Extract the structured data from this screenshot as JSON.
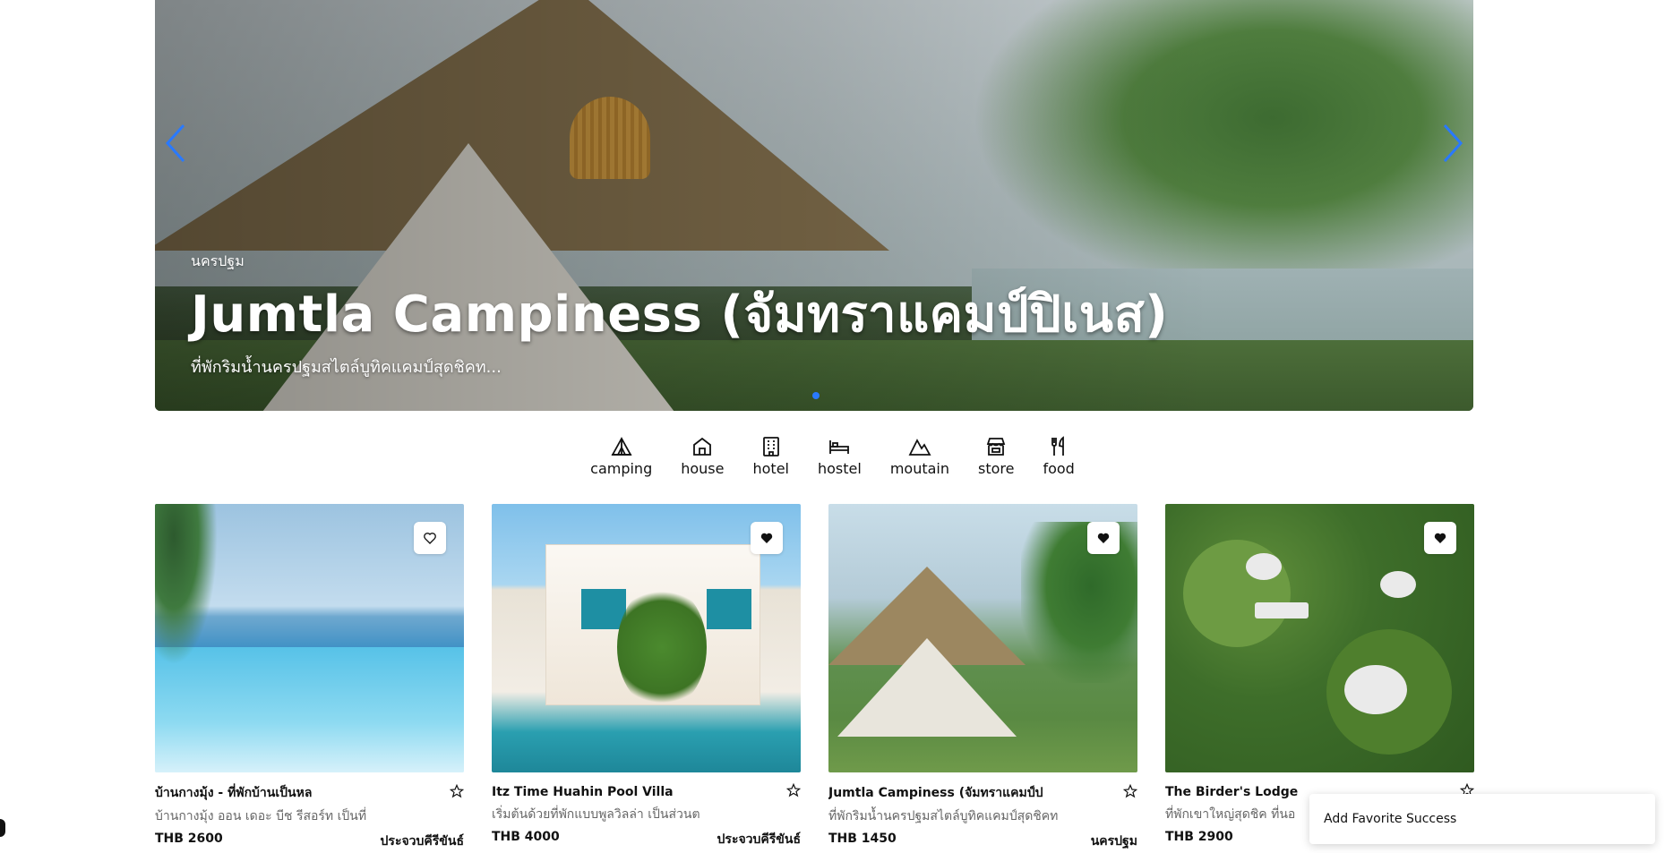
{
  "hero": {
    "province": "นครปฐม",
    "title": "Jumtla Campiness (จัมทราแคมป์ปิเนส)",
    "description": "ที่พักริมน้ำนครปฐมสไตล์บูทิคแคมป์สุดชิคท...",
    "prev_icon": "chevron-left-icon",
    "next_icon": "chevron-right-icon",
    "dot_color": "#2979ff"
  },
  "categories": [
    {
      "label": "camping",
      "icon": "tent-icon"
    },
    {
      "label": "house",
      "icon": "house-icon"
    },
    {
      "label": "hotel",
      "icon": "building-icon"
    },
    {
      "label": "hostel",
      "icon": "bed-icon"
    },
    {
      "label": "moutain",
      "icon": "mountain-icon"
    },
    {
      "label": "store",
      "icon": "store-icon"
    },
    {
      "label": "food",
      "icon": "utensils-icon"
    }
  ],
  "cards": [
    {
      "title": "บ้านกางมุ้ง - ที่พักบ้านเป็นหล",
      "description": "บ้านกางมุ้ง ออน เดอะ บีช รีสอร์ท เป็นที่",
      "price": "THB 2600",
      "province": "ประจวบคีรีขันธ์",
      "favorited": false
    },
    {
      "title": "Itz Time Huahin Pool Villa",
      "description": "เริ่มต้นด้วยที่พักแบบพูลวิลล่า เป็นส่วนต",
      "price": "THB 4000",
      "province": "ประจวบคีรีขันธ์",
      "favorited": true
    },
    {
      "title": "Jumtla Campiness (จัมทราแคมป์ป",
      "description": "ที่พักริมน้ำนครปฐมสไตล์บูทิคแคมป์สุดชิคท",
      "price": "THB 1450",
      "province": "นครปฐม",
      "favorited": true
    },
    {
      "title": "The Birder's Lodge",
      "description": "ที่พักเขาใหญ่สุดชิค ที่นอ",
      "price": "THB 2900",
      "province": "",
      "favorited": true
    }
  ],
  "toast": {
    "message": "Add Favorite Success"
  }
}
